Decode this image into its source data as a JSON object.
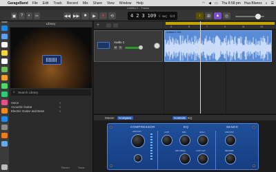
{
  "menubar": {
    "app_name": "GarageBand",
    "items": [
      "File",
      "Edit",
      "Track",
      "Record",
      "Mix",
      "Share",
      "View",
      "Window",
      "Help"
    ],
    "clock": "Thu 8:58 pm",
    "user": "Hua Blanes"
  },
  "window": {
    "title": "Untitled 1 - Tracks"
  },
  "lcd": {
    "bar": "4",
    "beat": "2",
    "position": "3",
    "tempo": "109",
    "key": "C maj",
    "time_sig": "4/4"
  },
  "library": {
    "title": "Library",
    "search_placeholder": "Search Library",
    "items": [
      {
        "label": "Voice",
        "x": "x"
      },
      {
        "label": "Acoustic Guitar",
        "x": "x"
      },
      {
        "label": "Electric Guitar and Bass",
        "x": "x"
      }
    ],
    "revert_label": "Revert",
    "save_label": "Save..."
  },
  "track": {
    "name": "Audio 1",
    "mute": "M",
    "solo": "S"
  },
  "region": {
    "name": "Untitled 1 #01"
  },
  "ruler": {
    "ticks": [
      "3",
      "5",
      "7",
      "9",
      "11",
      "13"
    ]
  },
  "smart_controls": {
    "master_label": "Master",
    "compare_label": "Compare",
    "controls_label": "Controls",
    "eq_label": "EQ"
  },
  "rack": {
    "sections": [
      "COMPRESSOR",
      "EQ",
      "SENDS"
    ],
    "knobs": [
      "AMOUNT",
      "LOW",
      "MID",
      "HIGH",
      "MID FREQ",
      "LOW CUT",
      "AMOUNT",
      "REVERB"
    ]
  }
}
